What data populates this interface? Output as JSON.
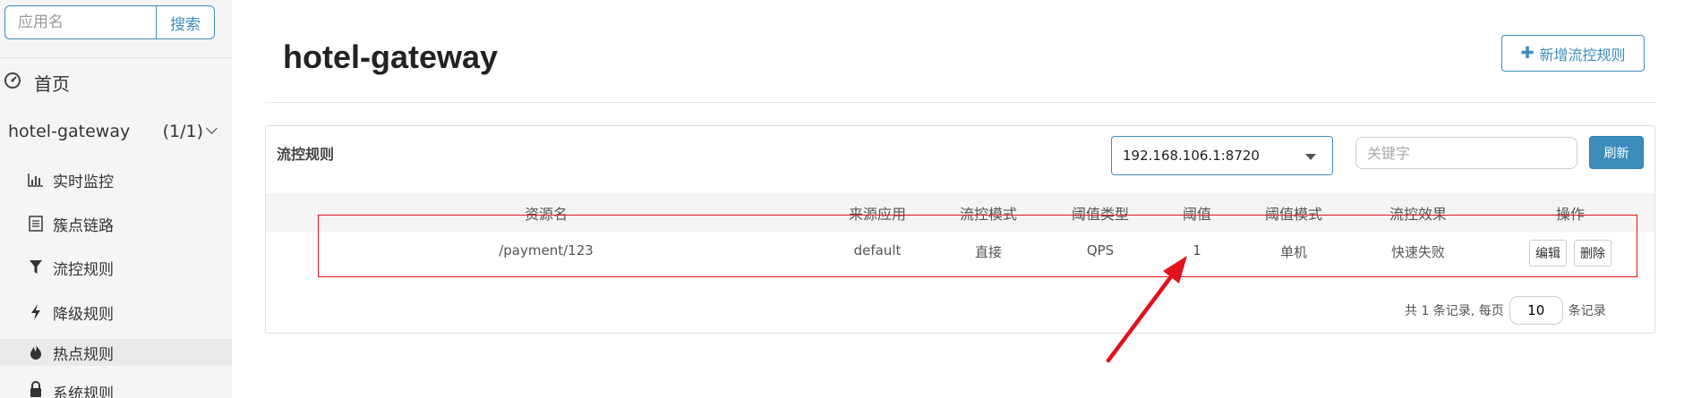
{
  "sidebar": {
    "search": {
      "placeholder": "应用名",
      "button_label": "搜索"
    },
    "home_label": "首页",
    "app": {
      "name": "hotel-gateway",
      "count": "(1/1)"
    },
    "items": [
      {
        "label": "实时监控",
        "icon": "bar-chart-icon"
      },
      {
        "label": "簇点链路",
        "icon": "list-icon"
      },
      {
        "label": "流控规则",
        "icon": "filter-icon"
      },
      {
        "label": "降级规则",
        "icon": "bolt-icon"
      },
      {
        "label": "热点规则",
        "icon": "fire-icon"
      },
      {
        "label": "系统规则",
        "icon": "lock-icon"
      }
    ]
  },
  "header": {
    "title": "hotel-gateway",
    "add_button_label": "新增流控规则"
  },
  "panel": {
    "title": "流控规则",
    "machine_select": "192.168.106.1:8720",
    "keyword_placeholder": "关键字",
    "refresh_label": "刷新",
    "columns": [
      "资源名",
      "来源应用",
      "流控模式",
      "阈值类型",
      "阈值",
      "阈值模式",
      "流控效果",
      "操作"
    ],
    "rows": [
      {
        "resource": "/payment/123",
        "source": "default",
        "mode": "直接",
        "threshold_type": "QPS",
        "threshold": "1",
        "cluster_mode": "单机",
        "effect": "快速失败",
        "edit_label": "编辑",
        "delete_label": "删除"
      }
    ],
    "pagination": {
      "prefix": "共 1 条记录, 每页",
      "page_size": "10",
      "suffix": "条记录"
    }
  },
  "annotation": {
    "highlight_color": "#e0121c"
  }
}
